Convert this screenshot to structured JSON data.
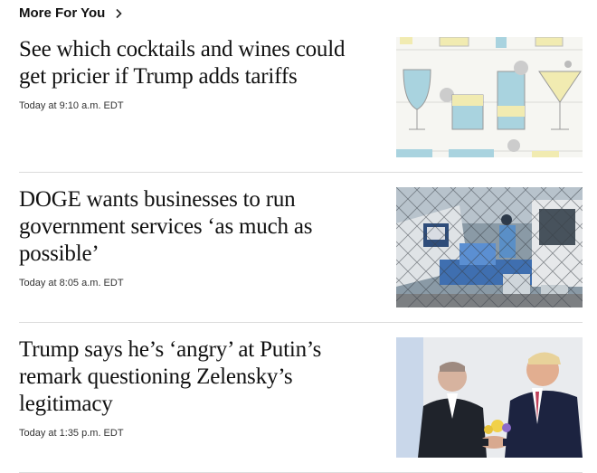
{
  "section": {
    "title": "More For You",
    "chevron_icon": "chevron-right-icon"
  },
  "stories": [
    {
      "headline": "See which cocktails and wines could get pricier if Trump adds tariffs",
      "timestamp": "Today at 9:10 a.m. EDT",
      "image_icon": "cocktail-glasses-illustration"
    },
    {
      "headline": "DOGE wants businesses to run government services ‘as much as possible’",
      "timestamp": "Today at 8:05 a.m. EDT",
      "image_icon": "postal-truck-photo"
    },
    {
      "headline": "Trump says he’s ‘angry’ at Putin’s remark questioning Zelensky’s legitimacy",
      "timestamp": "Today at 1:35 p.m. EDT",
      "image_icon": "handshake-photo"
    }
  ],
  "colors": {
    "divider": "#dcdcdc",
    "illustration_bg": "#f6f6f2",
    "glass_blue": "#a9d3df",
    "glass_yellow": "#f1ebb1"
  }
}
